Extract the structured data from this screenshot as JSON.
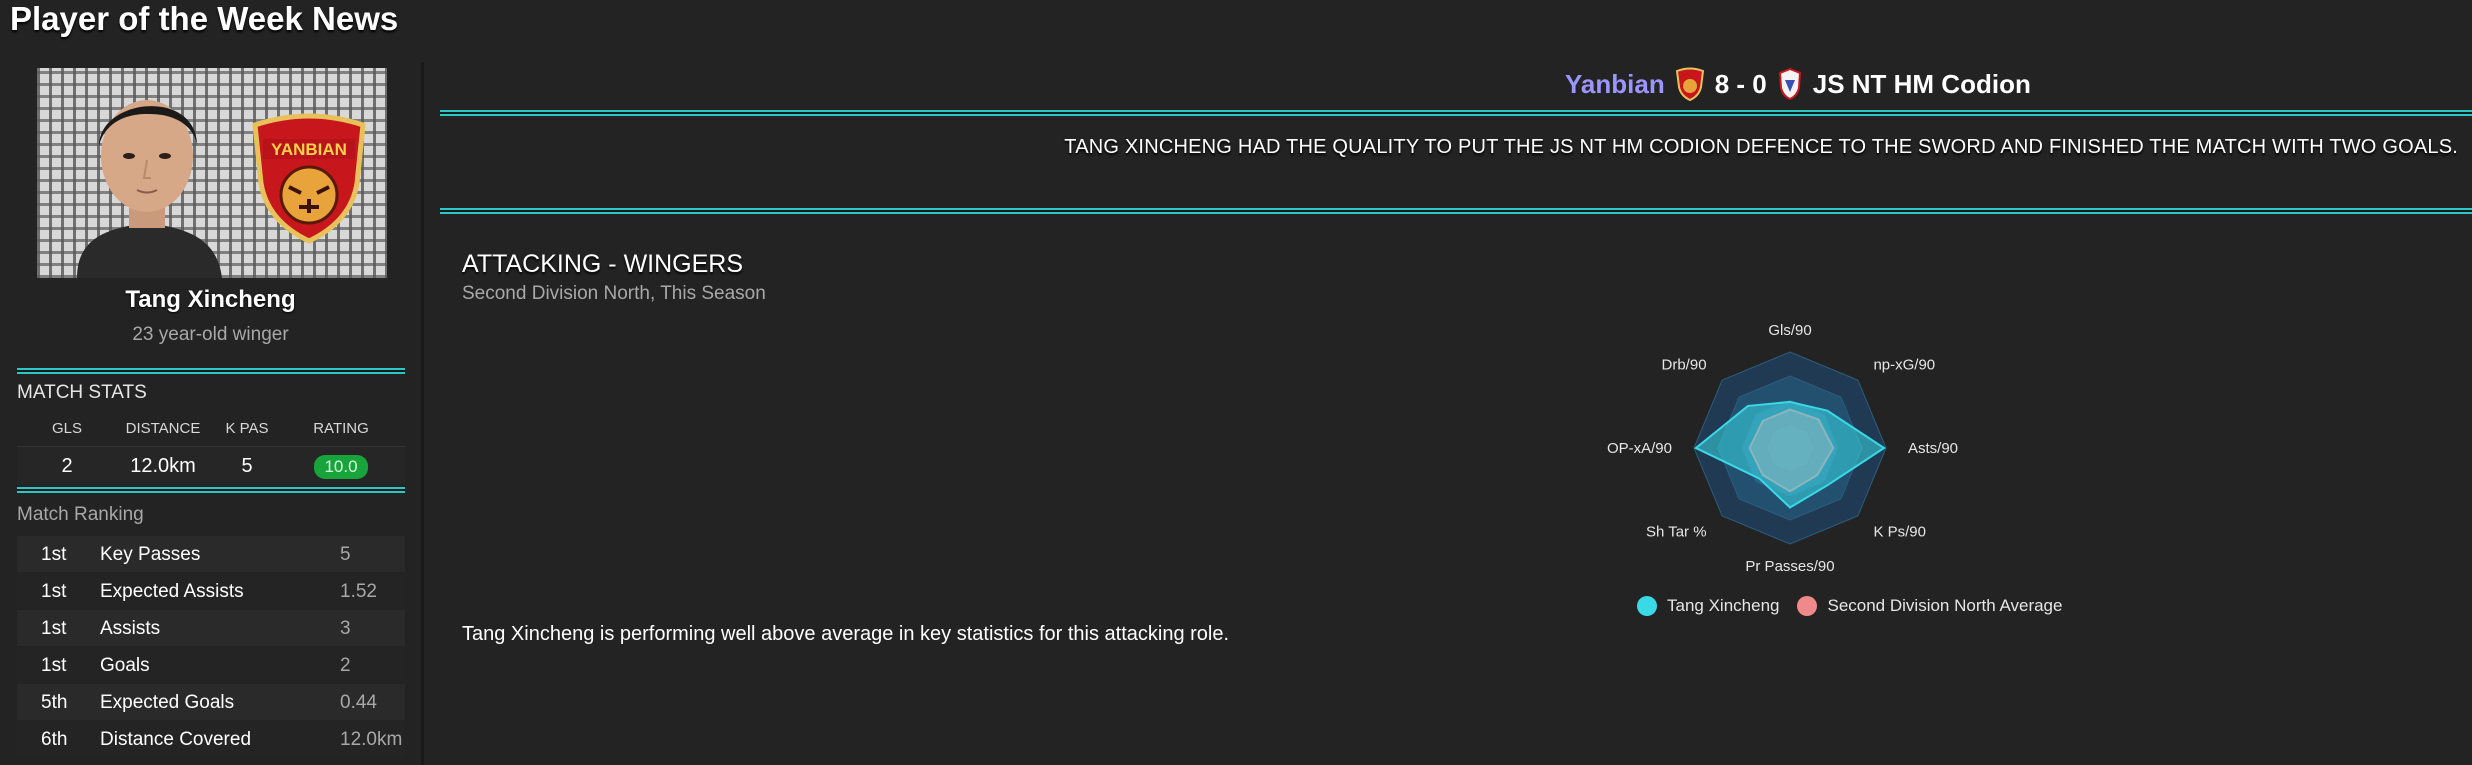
{
  "page": {
    "title": "Player of the Week News"
  },
  "player": {
    "name": "Tang Xincheng",
    "description": "23 year-old winger",
    "club_badge_text": "YANBIAN"
  },
  "match_stats": {
    "title": "MATCH STATS",
    "headers": [
      "GLS",
      "DISTANCE",
      "K PAS",
      "RATING"
    ],
    "values": [
      "2",
      "12.0km",
      "5",
      "10.0"
    ],
    "rating_color": "#19a33b"
  },
  "ranking": {
    "title": "Match Ranking",
    "rows": [
      {
        "pos": "1st",
        "stat": "Key Passes",
        "value": "5"
      },
      {
        "pos": "1st",
        "stat": "Expected Assists",
        "value": "1.52"
      },
      {
        "pos": "1st",
        "stat": "Assists",
        "value": "3"
      },
      {
        "pos": "1st",
        "stat": "Goals",
        "value": "2"
      },
      {
        "pos": "5th",
        "stat": "Expected Goals",
        "value": "0.44"
      },
      {
        "pos": "6th",
        "stat": "Distance Covered",
        "value": "12.0km"
      }
    ]
  },
  "match": {
    "home": "Yanbian",
    "score": "8 - 0",
    "away": "JS NT HM Codion",
    "home_color": "#9a95ff"
  },
  "headline": "TANG XINCHENG HAD THE QUALITY TO PUT THE JS NT HM CODION DEFENCE TO THE SWORD AND FINISHED THE MATCH WITH TWO GOALS.",
  "report": {
    "title": "ATTACKING - WINGERS",
    "subtitle": "Second Division North, This Season",
    "summary": "Tang Xincheng is performing well above average in key statistics for this attacking role."
  },
  "chart_data": {
    "type": "radar",
    "axes": [
      "Gls/90",
      "np-xG/90",
      "Asts/90",
      "K Ps/90",
      "Pr Passes/90",
      "Sh Tar %",
      "OP-xA/90",
      "Drb/90"
    ],
    "range": [
      0,
      1
    ],
    "series": [
      {
        "name": "Tang Xincheng",
        "color": "#3ad9e6",
        "values": [
          0.48,
          0.55,
          0.98,
          0.55,
          0.62,
          0.45,
          0.98,
          0.62
        ]
      },
      {
        "name": "Second Division North Average",
        "color": "#f08a8a",
        "values": [
          0.4,
          0.42,
          0.45,
          0.4,
          0.45,
          0.4,
          0.42,
          0.4
        ]
      }
    ]
  }
}
